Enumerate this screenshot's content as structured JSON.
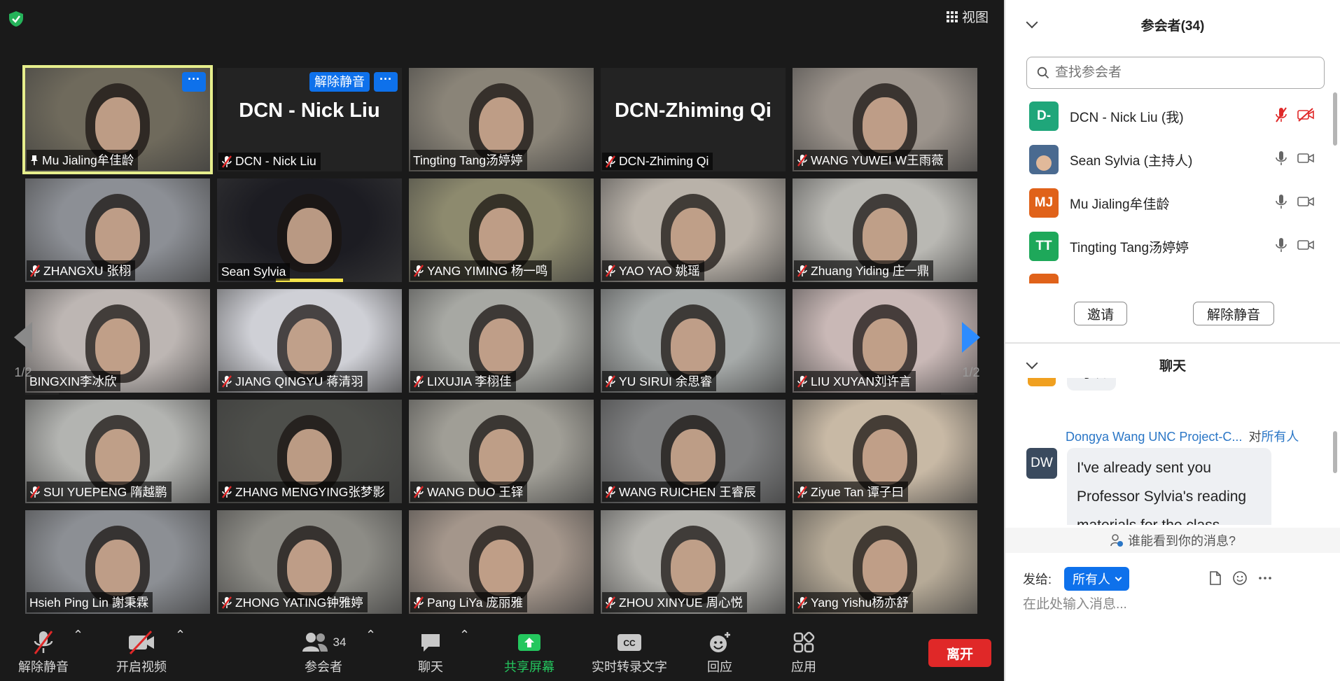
{
  "meeting": {
    "view_label": "视图",
    "page_indicator": "1/2",
    "tiles": [
      {
        "name": "Mu Jialing牟佳龄",
        "muted": false,
        "pinned": true,
        "active": true,
        "bg": "#6f6a5c",
        "more": "···"
      },
      {
        "name": "DCN - Nick Liu",
        "muted": true,
        "big_name": "DCN - Nick Liu",
        "unmute_chip": "解除静音",
        "more": "···"
      },
      {
        "name": "Tingting Tang汤婷婷",
        "muted": false,
        "bg": "#8a8478"
      },
      {
        "name": "DCN-Zhiming Qi",
        "muted": true,
        "big_name": "DCN-Zhiming Qi"
      },
      {
        "name": "WANG YUWEI W王雨薇",
        "muted": true,
        "bg": "#9c948c"
      },
      {
        "name": "ZHANGXU 张栩",
        "muted": true,
        "bg": "#8c8f95"
      },
      {
        "name": "Sean Sylvia",
        "muted": false,
        "bg": "#1c1c22",
        "speaking": true
      },
      {
        "name": "YANG YIMING 杨一鸣",
        "muted": true,
        "bg": "#8d8a6e"
      },
      {
        "name": "YAO YAO 姚瑶",
        "muted": true,
        "bg": "#b9b2a9"
      },
      {
        "name": "Zhuang Yiding 庄一鼎",
        "muted": true,
        "bg": "#b9b8b3"
      },
      {
        "name": "BINGXIN李冰欣",
        "muted": false,
        "bg": "#bdb6b3"
      },
      {
        "name": "JIANG QINGYU 蒋清羽",
        "muted": true,
        "bg": "#cfd0d6"
      },
      {
        "name": "LIXUJIA 李栩佳",
        "muted": true,
        "bg": "#a7a8a3"
      },
      {
        "name": "YU SIRUI 余思睿",
        "muted": true,
        "bg": "#a6aaa9"
      },
      {
        "name": "LIU XUYAN刘许言",
        "muted": true,
        "bg": "#c9b8b6"
      },
      {
        "name": "SUI YUEPENG 隋越鹏",
        "muted": true,
        "bg": "#b3b4b1"
      },
      {
        "name": "ZHANG MENGYING张梦影",
        "muted": true,
        "bg": "#4d4e4a"
      },
      {
        "name": "WANG DUO 王铎",
        "muted": true,
        "bg": "#a09e96"
      },
      {
        "name": "WANG RUICHEN 王睿辰",
        "muted": true,
        "bg": "#7e7f80"
      },
      {
        "name": "Ziyue Tan 谭子曰",
        "muted": true,
        "bg": "#c8b9a5"
      },
      {
        "name": "Hsieh Ping Lin 謝秉霖",
        "muted": false,
        "bg": "#8c8f94"
      },
      {
        "name": "ZHONG YATING钟雅婷",
        "muted": true,
        "bg": "#8d8c86"
      },
      {
        "name": "Pang LiYa 庞丽雅",
        "muted": true,
        "bg": "#a4968b"
      },
      {
        "name": "ZHOU XINYUE 周心悦",
        "muted": true,
        "bg": "#b4b3ae"
      },
      {
        "name": "Yang Yishu杨亦舒",
        "muted": true,
        "bg": "#b6aa97"
      }
    ]
  },
  "toolbar": {
    "unmute": "解除静音",
    "start_video": "开启视频",
    "participants": "参会者",
    "participants_count": "34",
    "chat": "聊天",
    "share": "共享屏幕",
    "cc_badge": "CC",
    "transcript": "实时转录文字",
    "reactions": "回应",
    "apps": "应用",
    "leave": "离开"
  },
  "participants_panel": {
    "title": "参会者(34)",
    "search_placeholder": "查找参会者",
    "people": [
      {
        "avatar": "D-",
        "color": "#1fa67a",
        "name": "DCN - Nick Liu (我)",
        "muted": true,
        "video_off": true
      },
      {
        "avatar": "",
        "color": "#4a6a90",
        "name": "Sean Sylvia (主持人)",
        "muted": false,
        "video_off": false
      },
      {
        "avatar": "MJ",
        "color": "#e0621a",
        "name": "Mu Jialing牟佳龄",
        "muted": false,
        "video_off": false
      },
      {
        "avatar": "TT",
        "color": "#1ea85a",
        "name": "Tingting Tang汤婷婷",
        "muted": false,
        "video_off": false
      }
    ],
    "invite": "邀请",
    "unmute_me": "解除静音"
  },
  "chat_panel": {
    "title": "聊天",
    "prev_message": "可以",
    "message": {
      "avatar": "DW",
      "sender": "Dongya Wang UNC Project-C...",
      "to": "对",
      "audience": "所有人",
      "lines": [
        "I've already sent you",
        "Professor Sylvia's reading",
        "materials for the class"
      ]
    },
    "who_can_see": "谁能看到你的消息?",
    "send_to_label": "发给:",
    "recipient": "所有人",
    "input_placeholder": "在此处输入消息..."
  }
}
